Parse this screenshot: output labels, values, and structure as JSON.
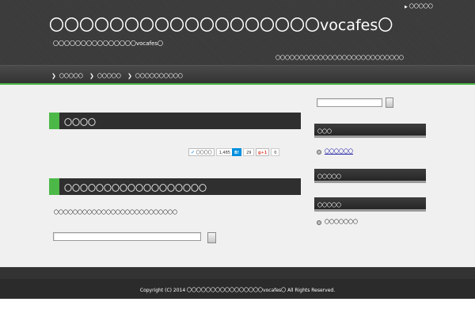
{
  "header": {
    "site_title": "〇〇〇〇〇〇〇〇〇〇〇〇〇〇〇〇〇〇vocafes〇",
    "tagline": "〇〇〇〇〇〇〇〇〇〇〇〇〇〇〇vocafes〇",
    "description": "〇〇〇〇〇〇〇〇〇〇〇〇〇〇〇〇〇〇〇〇〇〇〇〇〇〇〇",
    "top_link": "〇〇〇〇〇",
    "top_link_icon": "triangle-right-icon"
  },
  "nav": {
    "items": [
      {
        "label": "〇〇〇〇〇",
        "icon": "chevron-right-icon"
      },
      {
        "label": "〇〇〇〇〇",
        "icon": "chevron-right-icon"
      },
      {
        "label": "〇〇〇〇〇〇〇〇〇〇",
        "icon": "chevron-right-icon"
      }
    ],
    "accent_color": "#4cb848"
  },
  "main": {
    "entry1_title": "〇〇〇〇",
    "social": {
      "twitter_label": "〇〇〇〇",
      "twitter_count": "1,485",
      "hatena_label": "B!",
      "hatena_count": "29",
      "gplus_label": "g+1",
      "gplus_count": "0"
    },
    "entry2_title": "〇〇〇〇〇〇〇〇〇〇〇〇〇〇〇〇〇〇",
    "notfound_text": "〇〇〇〇〇〇〇〇〇〇〇〇〇〇〇〇〇〇〇〇〇〇〇〇〇〇",
    "search_value": "",
    "search_button_label": ""
  },
  "sidebar": {
    "search_value": "",
    "widgets": [
      {
        "title": "〇〇〇",
        "items": [
          {
            "label": "〇〇〇〇〇〇",
            "is_link": true
          }
        ]
      },
      {
        "title": "〇〇〇〇〇",
        "items": []
      },
      {
        "title": "〇〇〇〇〇",
        "items": [
          {
            "label": "〇〇〇〇〇〇〇",
            "is_link": false
          }
        ]
      }
    ]
  },
  "footer": {
    "copyright": "Copyright (C) 2014 〇〇〇〇〇〇〇〇〇〇〇〇〇〇〇〇vocafes〇 All Rights Reserved."
  }
}
